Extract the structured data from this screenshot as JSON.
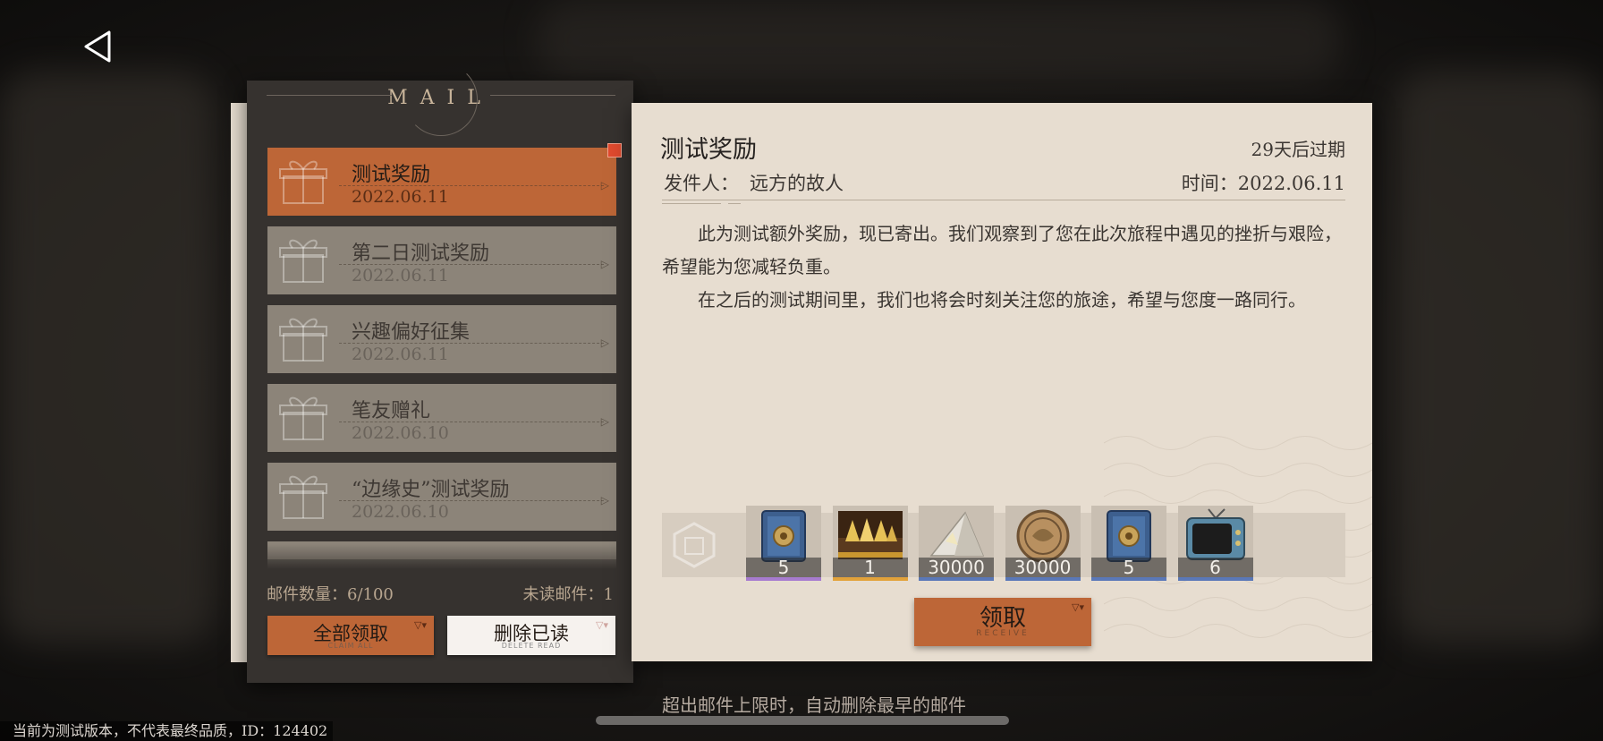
{
  "colors": {
    "accent": "#bd6637",
    "panel_dark": "#36322f",
    "paper": "#e7ddd0",
    "unread_dot": "#e04a2e"
  },
  "nav": {
    "back_icon": "back-triangle-icon"
  },
  "mail_panel": {
    "title": "MAIL",
    "items": [
      {
        "title": "测试奖励",
        "date": "2022.06.11",
        "active": true,
        "unread": true
      },
      {
        "title": "第二日测试奖励",
        "date": "2022.06.11"
      },
      {
        "title": "兴趣偏好征集",
        "date": "2022.06.11"
      },
      {
        "title": "笔友赠礼",
        "date": "2022.06.10"
      },
      {
        "title": "“边缘史”测试奖励",
        "date": "2022.06.10"
      }
    ],
    "count_label": "邮件数量：6/100",
    "unread_label": "未读邮件：1",
    "claim_all": {
      "label": "全部领取",
      "sub": "CLAIM ALL"
    },
    "delete_read": {
      "label": "删除已读",
      "sub": "DELETE READ"
    }
  },
  "detail": {
    "title": "测试奖励",
    "expire": "29天后过期",
    "sender_label": "发件人：",
    "sender": "远方的故人",
    "time": "时间：2022.06.11",
    "paragraphs": [
      "此为测试额外奖励，现已寄出。我们观察到了您在此次旅程中遇见的挫折与艰险，希望能为您减轻负重。",
      "在之后的测试期间里，我们也将会时刻关注您的旅途，希望与您度一路同行。"
    ],
    "rewards": [
      {
        "icon": "blue-safe-icon",
        "qty": "5",
        "rarity": "#a77bd0"
      },
      {
        "icon": "golden-treasure-chest-icon",
        "qty": "1",
        "rarity": "#e2a23a"
      },
      {
        "icon": "crystal-shard-icon",
        "qty": "30000",
        "rarity": "#5a78b8"
      },
      {
        "icon": "bronze-coin-icon",
        "qty": "30000",
        "rarity": "#5a78b8"
      },
      {
        "icon": "blue-safe-icon",
        "qty": "5",
        "rarity": "#5a78b8"
      },
      {
        "icon": "retro-tv-icon",
        "qty": "6",
        "rarity": "#5a78b8"
      }
    ],
    "receive": {
      "label": "领取",
      "sub": "RECEIVE"
    }
  },
  "footer_note": "超出邮件上限时，自动删除最早的邮件",
  "version_text": "当前为测试版本，不代表最终品质，ID：124402"
}
